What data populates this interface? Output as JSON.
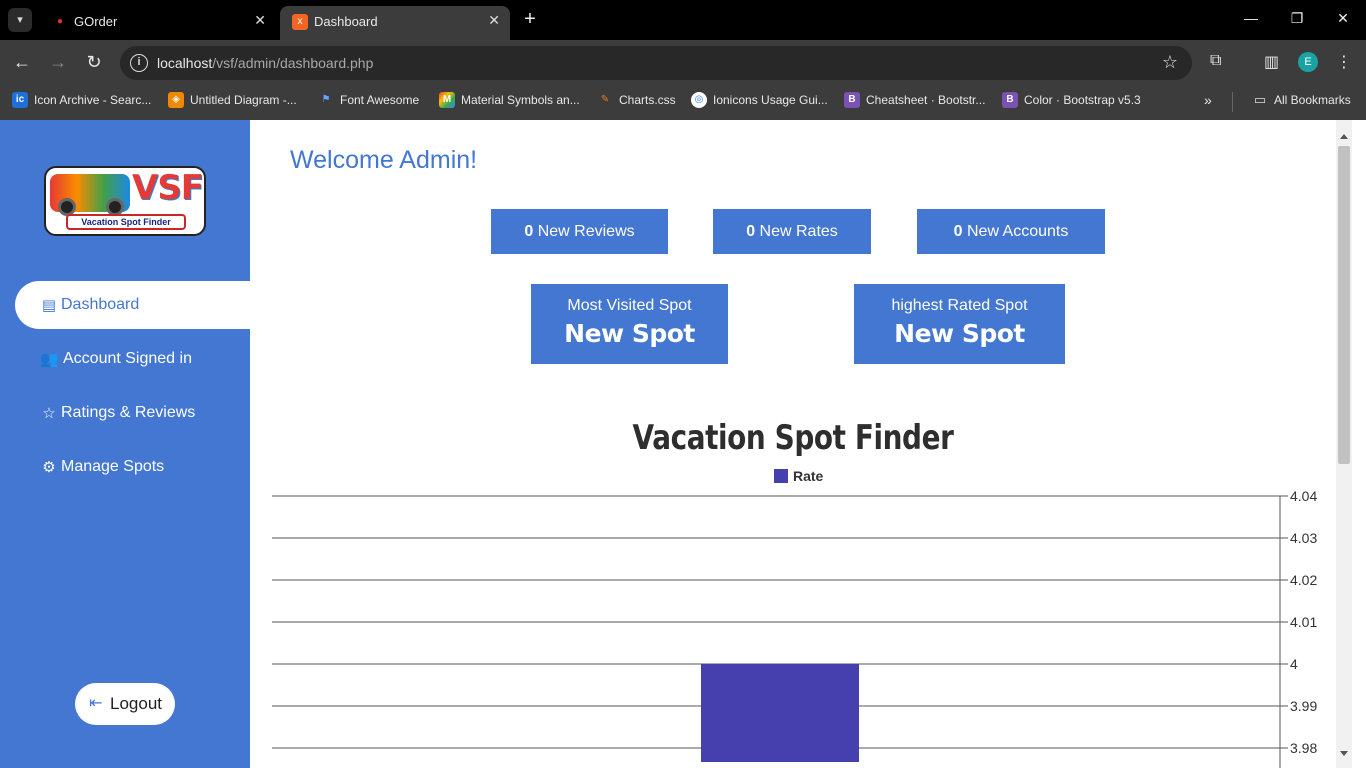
{
  "browser": {
    "tabs": [
      {
        "title": "GOrder",
        "icon": "grab-icon"
      },
      {
        "title": "Dashboard",
        "icon": "xampp-icon",
        "active": true
      }
    ],
    "url_host": "localhost",
    "url_path": "/vsf/admin/dashboard.php",
    "profile_initial": "E",
    "bookmarks": [
      {
        "label": "Icon Archive - Searc...",
        "icon": "ic",
        "color": "#1e6fd9"
      },
      {
        "label": "Untitled Diagram -...",
        "icon": "drawio",
        "color": "#f08705"
      },
      {
        "label": "Font Awesome",
        "icon": "flag",
        "color": "#3b82f6"
      },
      {
        "label": "Material Symbols an...",
        "icon": "material",
        "color": "#34a853"
      },
      {
        "label": "Charts.css",
        "icon": "charts",
        "color": "#c0392b"
      },
      {
        "label": "Ionicons Usage Gui...",
        "icon": "ionicons",
        "color": "#3880ff"
      },
      {
        "label": "Cheatsheet · Bootstr...",
        "icon": "B",
        "color": "#7952b3"
      },
      {
        "label": "Color · Bootstrap v5.3",
        "icon": "B",
        "color": "#7952b3"
      }
    ],
    "all_bookmarks": "All Bookmarks"
  },
  "sidebar": {
    "logo_text": "VSF",
    "logo_tagline": "Vacation Spot Finder",
    "items": [
      {
        "label": "Dashboard",
        "icon": "table-list-icon",
        "active": true
      },
      {
        "label": "Account Signed in",
        "icon": "users-icon"
      },
      {
        "label": "Ratings & Reviews",
        "icon": "star-icon"
      },
      {
        "label": "Manage Spots",
        "icon": "gear-icon"
      }
    ],
    "logout_label": "Logout"
  },
  "main": {
    "welcome": "Welcome Admin!",
    "stats": [
      {
        "count": "0",
        "label": "New Reviews"
      },
      {
        "count": "0",
        "label": "New Rates"
      },
      {
        "count": "0",
        "label": "New Accounts"
      }
    ],
    "spots": [
      {
        "label": "Most Visited Spot",
        "value": "New Spot"
      },
      {
        "label": "highest Rated Spot",
        "value": "New Spot"
      }
    ]
  },
  "colors": {
    "primary": "#4377d1",
    "bar": "#4540ad"
  },
  "chart_data": {
    "type": "bar",
    "title": "Vacation Spot Finder",
    "series": [
      {
        "name": "Rate",
        "values": [
          4.0
        ]
      }
    ],
    "categories": [
      ""
    ],
    "y_ticks": [
      "4.04",
      "4.03",
      "4.02",
      "4.01",
      "4",
      "3.99",
      "3.98"
    ],
    "ylim": [
      3.977,
      4.04
    ],
    "y_axis_position": "right",
    "legend_position": "top",
    "grid": true
  }
}
